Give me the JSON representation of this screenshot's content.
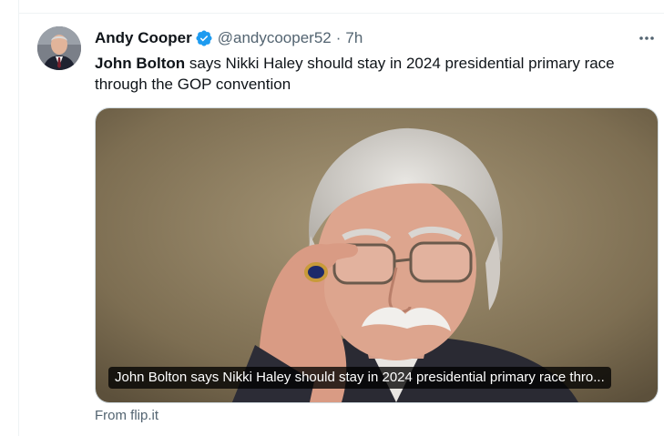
{
  "tweet": {
    "author_name": "Andy Cooper",
    "handle": "@andycooper52",
    "separator": "·",
    "time": "7h",
    "text_bold": "John Bolton",
    "text_rest": " says Nikki Haley should stay in 2024 presidential primary race through the GOP convention",
    "card_caption": "John Bolton says Nikki Haley should stay in 2024 presidential primary race thro...",
    "source": "From flip.it"
  },
  "icons": {
    "verified": "verified-badge-icon",
    "more": "more-options-icon"
  },
  "colors": {
    "verified_blue": "#1d9bf0",
    "secondary_text": "#536471",
    "primary_text": "#0f1419"
  }
}
